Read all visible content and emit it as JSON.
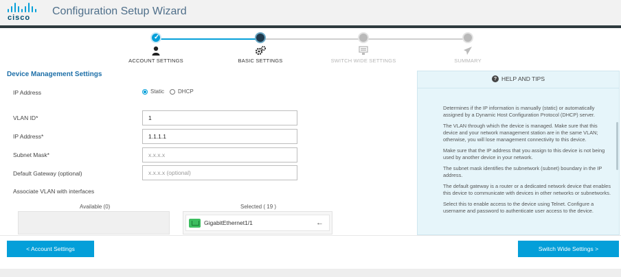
{
  "header": {
    "logo_text": "cisco",
    "title": "Configuration Setup Wizard"
  },
  "wizard": {
    "steps": [
      {
        "label": "ACCOUNT SETTINGS",
        "state": "done",
        "icon": "user-icon"
      },
      {
        "label": "BASIC SETTINGS",
        "state": "current",
        "icon": "gears-icon"
      },
      {
        "label": "SWITCH WIDE SETTINGS",
        "state": "todo",
        "icon": "switch-icon"
      },
      {
        "label": "SUMMARY",
        "state": "todo",
        "icon": "send-icon"
      }
    ]
  },
  "form": {
    "section_title": "Device Management Settings",
    "ip_address_label": "IP Address",
    "radio_static": "Static",
    "radio_dhcp": "DHCP",
    "vlan_id_label": "VLAN ID*",
    "vlan_id_value": "1",
    "ip_label": "IP Address*",
    "ip_value": "1.1.1.1",
    "subnet_label": "Subnet Mask*",
    "subnet_placeholder": "x.x.x.x",
    "gateway_label": "Default Gateway (optional)",
    "gateway_placeholder": "x.x.x.x (optional)",
    "assoc_label": "Associate VLAN with interfaces",
    "available_header": "Available (0)",
    "selected_header": "Selected ( 19 )",
    "selected_items": [
      "GigabitEthernet1/1"
    ]
  },
  "help": {
    "title": "HELP AND TIPS",
    "tips": [
      "Determines if the IP information is manually (static) or automatically assigned by a Dynamic Host Configuration Protocol (DHCP) server.",
      "The VLAN through which the device is managed. Make sure that this device and your network management station are in the same VLAN; otherwise, you will lose management connectivity to this device.",
      "Make sure that the IP address that you assign to this device is not being used by another device in your network.",
      "The subnet mask identifies the subnetwork (subnet) boundary in the IP address.",
      "The default gateway is a router or a dedicated network device that enables this device to communicate with devices in other networks or subnetworks.",
      "Select this to enable access to the device using Telnet. Configure a username and password to authenticate user access to the device."
    ]
  },
  "footer": {
    "prev_label": "< Account Settings",
    "next_label": "Switch Wide Settings >"
  },
  "colors": {
    "accent": "#049fd9",
    "brand_dark": "#005073",
    "help_bg": "#e6f5fa",
    "port_green": "#3cbd5f"
  }
}
